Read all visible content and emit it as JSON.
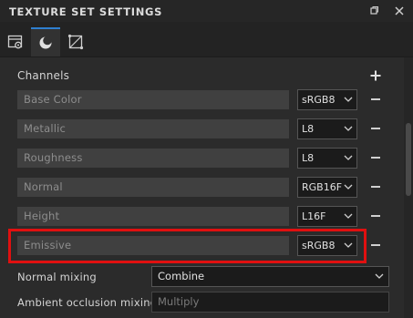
{
  "window": {
    "title": "TEXTURE SET SETTINGS"
  },
  "tabs": [
    {
      "name": "texture-set-settings-tab",
      "icon": "settings-icon"
    },
    {
      "name": "baking-tab",
      "icon": "bake-icon",
      "active": true
    },
    {
      "name": "uv-tab",
      "icon": "uv-icon"
    }
  ],
  "channels": {
    "header": "Channels",
    "items": [
      {
        "name": "Base Color",
        "format": "sRGB8"
      },
      {
        "name": "Metallic",
        "format": "L8"
      },
      {
        "name": "Roughness",
        "format": "L8"
      },
      {
        "name": "Normal",
        "format": "RGB16F"
      },
      {
        "name": "Height",
        "format": "L16F"
      },
      {
        "name": "Emissive",
        "format": "sRGB8",
        "highlighted": true
      }
    ]
  },
  "properties": {
    "normal_mixing_label": "Normal mixing",
    "normal_mixing_value": "Combine",
    "ao_mixing_label": "Ambient occlusion mixing",
    "ao_mixing_value": "Multiply"
  },
  "colors": {
    "highlight": "#e01010",
    "accent": "#2f7fd0",
    "background": "#2b2b2b"
  }
}
